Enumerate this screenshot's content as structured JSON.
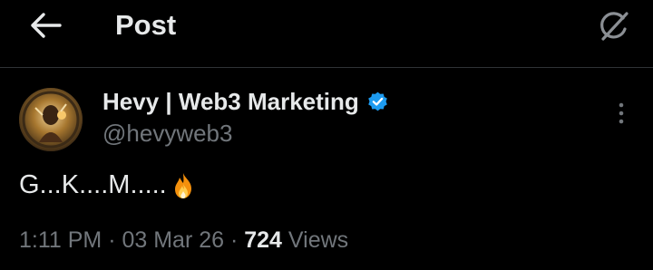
{
  "header": {
    "title": "Post",
    "back_icon": "arrow-left-icon",
    "grok_icon": "grok-icon"
  },
  "post": {
    "author_name": "Hevy | Web3 Marketing",
    "verified": true,
    "verified_color": "#1d9bf0",
    "handle": "@hevyweb3",
    "text": "G...K....M.....",
    "emoji": "fire-emoji",
    "time": "1:11 PM",
    "date": "03 Mar 26",
    "views_count": "724",
    "views_label": "Views"
  },
  "colors": {
    "background": "#000000",
    "text_primary": "#e7e9ea",
    "text_secondary": "#71767b",
    "divider": "#2f3336"
  }
}
